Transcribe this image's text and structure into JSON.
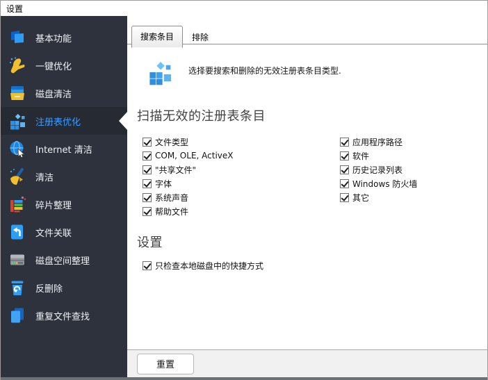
{
  "window": {
    "title": "设置"
  },
  "sidebar": {
    "items": [
      {
        "name": "basic-functions",
        "label": "基本功能",
        "icon": "basic-functions-icon",
        "selected": false
      },
      {
        "name": "one-click-optimize",
        "label": "一键优化",
        "icon": "one-click-optimize-icon",
        "selected": false
      },
      {
        "name": "disk-cleanup",
        "label": "磁盘清洁",
        "icon": "disk-cleanup-icon",
        "selected": false
      },
      {
        "name": "registry-optimize",
        "label": "注册表优化",
        "icon": "registry-optimize-icon",
        "selected": true
      },
      {
        "name": "internet-cleanup",
        "label": "Internet 清洁",
        "icon": "internet-cleanup-icon",
        "selected": false
      },
      {
        "name": "cleanup",
        "label": "清洁",
        "icon": "cleanup-icon",
        "selected": false
      },
      {
        "name": "defrag",
        "label": "碎片整理",
        "icon": "defrag-icon",
        "selected": false
      },
      {
        "name": "file-association",
        "label": "文件关联",
        "icon": "file-association-icon",
        "selected": false
      },
      {
        "name": "disk-space",
        "label": "磁盘空间整理",
        "icon": "disk-space-icon",
        "selected": false
      },
      {
        "name": "undelete",
        "label": "反删除",
        "icon": "undelete-icon",
        "selected": false
      },
      {
        "name": "duplicate-finder",
        "label": "重复文件查找",
        "icon": "duplicate-finder-icon",
        "selected": false
      }
    ]
  },
  "tabs": [
    {
      "name": "search-entries",
      "label": "搜索条目",
      "active": true
    },
    {
      "name": "exclude",
      "label": "排除",
      "active": false
    }
  ],
  "header": {
    "icon": "registry-optimize-icon",
    "description": "选择要搜索和删除的无效注册表条目类型."
  },
  "scan_section": {
    "title": "扫描无效的注册表条目",
    "left_items": [
      {
        "label": "文件类型",
        "checked": true
      },
      {
        "label": "COM, OLE, ActiveX",
        "checked": true
      },
      {
        "label": "\"共享文件\"",
        "checked": true
      },
      {
        "label": "字体",
        "checked": true
      },
      {
        "label": "系统声音",
        "checked": true
      },
      {
        "label": "帮助文件",
        "checked": true
      }
    ],
    "right_items": [
      {
        "label": "应用程序路径",
        "checked": true
      },
      {
        "label": "软件",
        "checked": true
      },
      {
        "label": "历史记录列表",
        "checked": true
      },
      {
        "label": "Windows 防火墙",
        "checked": true
      },
      {
        "label": "其它",
        "checked": true
      }
    ]
  },
  "settings_section": {
    "title": "设置",
    "items": [
      {
        "label": "只检查本地磁盘中的快捷方式",
        "checked": true
      }
    ]
  },
  "footer": {
    "reset_label": "重置"
  },
  "colors": {
    "accent_blue": "#3f9bfa",
    "sidebar_bg": "#2d323c",
    "sidebar_selected_bg": "#262a32",
    "footer_bg": "#f1f1f1"
  }
}
